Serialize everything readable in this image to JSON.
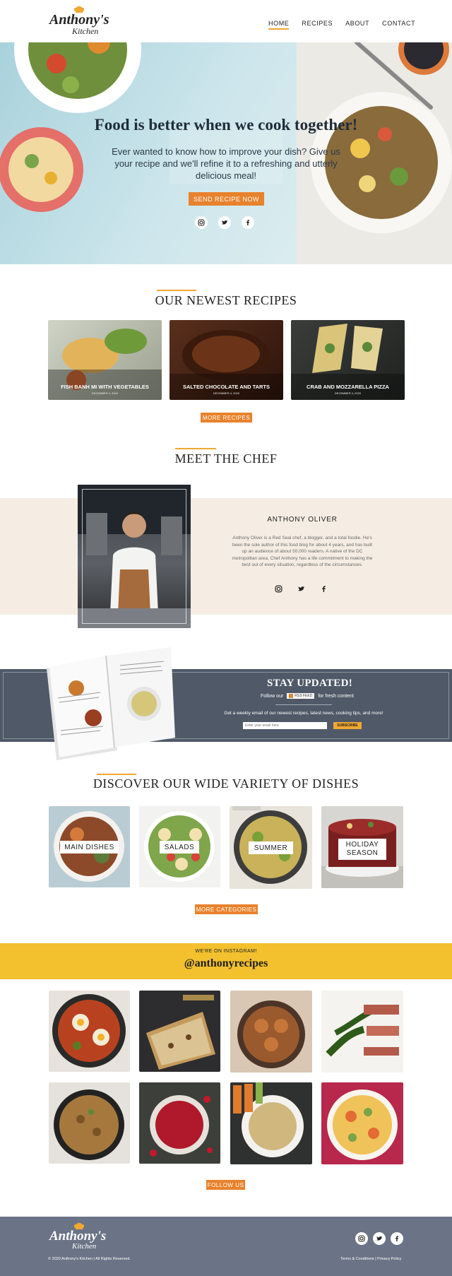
{
  "colors": {
    "accent": "#e8822c",
    "rule": "#f0a830",
    "navy": "#4f5968",
    "footer": "#6b7486",
    "cream": "#f5ede3",
    "insta_band": "#f3c02e"
  },
  "header": {
    "logo_line1": "Anthony's",
    "logo_line2": "Kitchen",
    "nav": [
      {
        "label": "HOME",
        "active": true
      },
      {
        "label": "RECIPES",
        "active": false
      },
      {
        "label": "ABOUT",
        "active": false
      },
      {
        "label": "CONTACT",
        "active": false
      }
    ]
  },
  "hero": {
    "title": "Food is better when we cook together!",
    "subtitle": "Ever wanted to know how to improve your dish? Give us your recipe and we'll refine it to a refreshing and utterly delicious meal!",
    "cta": "SEND RECIPE NOW",
    "social_icons": [
      "instagram-icon",
      "twitter-icon",
      "facebook-icon"
    ]
  },
  "newest": {
    "title": "OUR NEWEST RECIPES",
    "recipes": [
      {
        "name": "FISH BANH MI WITH VEGETABLES",
        "date": "DECEMBER 4, 2020"
      },
      {
        "name": "SALTED CHOCOLATE AND TARTS",
        "date": "DECEMBER 4, 2020"
      },
      {
        "name": "CRAB AND MOZZARELLA PIZZA",
        "date": "DECEMBER 4, 2020"
      }
    ],
    "more": "MORE RECIPES"
  },
  "chef": {
    "section_title": "MEET THE CHEF",
    "name": "ANTHONY OLIVER",
    "bio": "Anthony Oliver is a Red Seal chef, a blogger, and a total foodie. He's been the sole author of this food blog for about 4 years, and has built up an audience of about 50,000 readers. A native of the DC metropolitan area, Chef Anthony has a life commitment to making the best out of every situation, regardless of the circumstances."
  },
  "newsletter": {
    "title": "STAY UPDATED!",
    "follow_prefix": "Follow our",
    "badge": "RSS FEED",
    "follow_suffix": "for fresh content",
    "description": "Get a weekly email of our newest recipes, latest news, cooking tips, and more!",
    "email_placeholder": "Enter your email here",
    "subscribe": "SUBSCRIBE"
  },
  "dishes": {
    "title": "DISCOVER OUR WIDE VARIETY OF DISHES",
    "categories": [
      {
        "label": "MAIN DISHES"
      },
      {
        "label": "SALADS"
      },
      {
        "label": "SUMMER"
      },
      {
        "label": "HOLIDAY SEASON"
      }
    ],
    "more": "MORE CATEGORIES"
  },
  "instagram": {
    "kicker": "WE'RE ON INSTAGRAM!",
    "handle": "@anthonyrecipes",
    "follow": "FOLLOW US"
  },
  "footer": {
    "logo_line1": "Anthony's",
    "logo_line2": "Kitchen",
    "copyright": "© 2020 Anthony's Kitchen | All Rights Reserved.",
    "links": "Terms & Conditions | Privacy Policy"
  }
}
